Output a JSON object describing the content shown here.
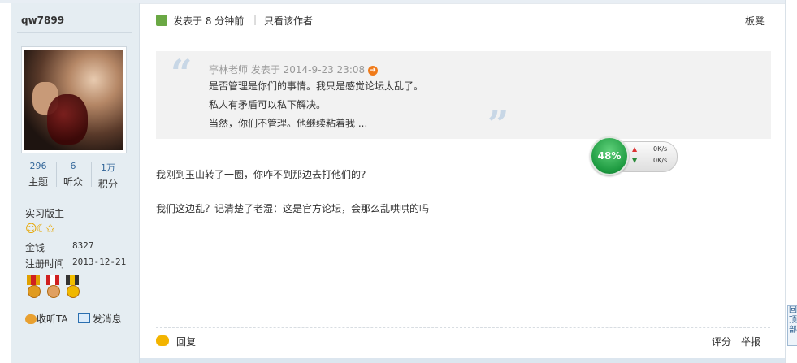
{
  "author": {
    "username": "qw7899",
    "stats": [
      {
        "value": "296",
        "label": "主题"
      },
      {
        "value": "6",
        "label": "听众"
      },
      {
        "value": "1万",
        "label": "积分"
      }
    ],
    "rank": "实习版主",
    "stars_icons": "☺☾✩",
    "money_label": "金钱",
    "money_value": "8327",
    "reg_label": "注册时间",
    "reg_value": "2013-12-21",
    "follow_label": "收听TA",
    "message_label": "发消息"
  },
  "post": {
    "posted_prefix": "发表于",
    "posted_time": "8 分钟前",
    "only_author": "只看该作者",
    "floor": "板凳",
    "quote": {
      "author_line": "亭林老师 发表于 2014-9-23 23:08",
      "lines": [
        "是否管理是你们的事情。我只是感觉论坛太乱了。",
        "私人有矛盾可以私下解决。",
        "当然，你们不管理。他继续粘着我 ..."
      ]
    },
    "body": [
      "我刚到玉山转了一圈，你咋不到那边去打他们的?",
      "我们这边乱？记清楚了老湿：这是官方论坛，会那么乱哄哄的吗"
    ],
    "reply_label": "回复",
    "rate_label": "评分",
    "report_label": "举报"
  },
  "net_widget": {
    "percent": "48%",
    "up_rate": "0K/s",
    "down_rate": "0K/s"
  },
  "side_tab_label": "回顶部"
}
